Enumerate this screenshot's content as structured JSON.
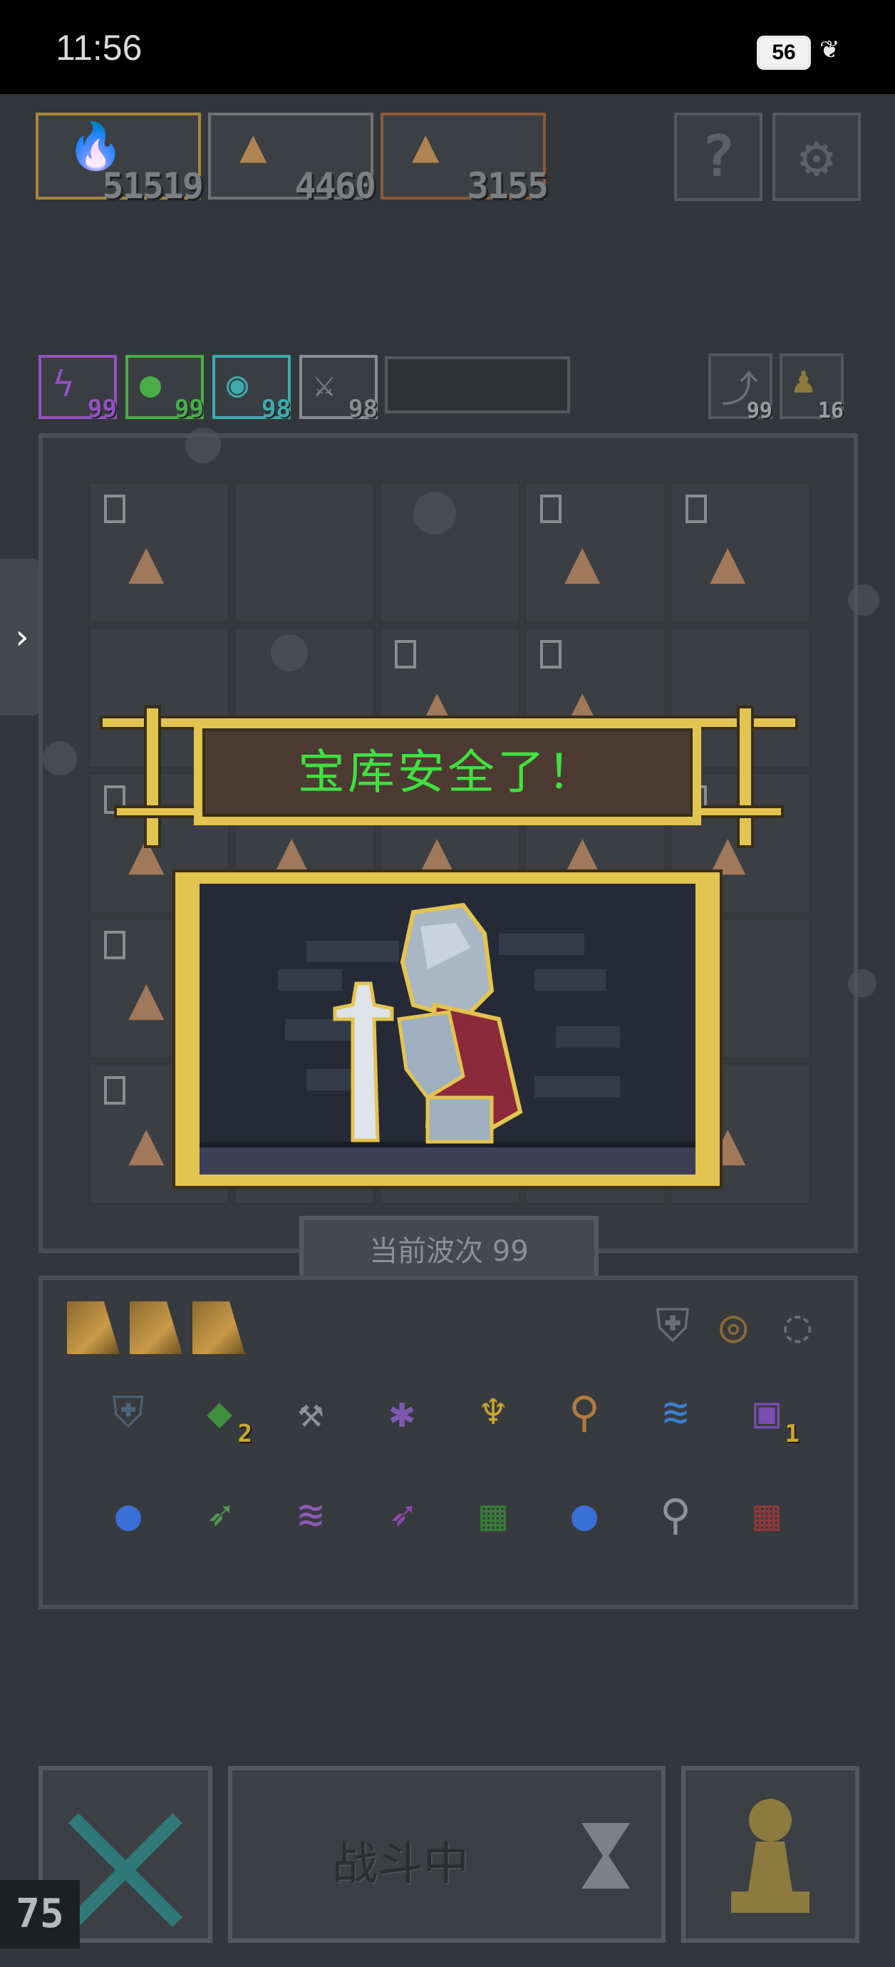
{
  "status_bar": {
    "time": "11:56",
    "battery": "56"
  },
  "resources": [
    {
      "id": "blue-gem",
      "amount": "51519",
      "border": "#a5873a",
      "icon": "blue-flame-icon",
      "color": "#4a7fd6"
    },
    {
      "id": "ore-1",
      "amount": "4460",
      "border": "#6e7275",
      "icon": "ore-pile-icon",
      "color": "#b08452"
    },
    {
      "id": "ore-2",
      "amount": "3155",
      "border": "#8b5a3a",
      "icon": "ore-pile-icon",
      "color": "#b08452"
    }
  ],
  "top_buttons": {
    "help": "?",
    "settings": "⚙"
  },
  "skills": [
    {
      "icon": "lightning-icon",
      "value": "99",
      "color": "#a259d9"
    },
    {
      "icon": "green-potion-icon",
      "value": "99",
      "color": "#4cc24c"
    },
    {
      "icon": "cyan-orb-icon",
      "value": "98",
      "color": "#3fc0c0"
    },
    {
      "icon": "crossed-swords-icon",
      "value": "98",
      "color": "#9a9ea2"
    }
  ],
  "counters": [
    {
      "icon": "return-arrow-icon",
      "value": "99"
    },
    {
      "icon": "pawn-icon",
      "value": "16"
    }
  ],
  "board": {
    "badge": "0",
    "cells": [
      [
        true,
        false,
        false,
        true,
        true
      ],
      [
        false,
        false,
        true,
        true,
        false
      ],
      [
        true,
        true,
        true,
        true,
        true
      ],
      [
        true,
        false,
        false,
        false,
        false
      ],
      [
        true,
        false,
        false,
        false,
        true
      ]
    ]
  },
  "banner": {
    "text": "宝库安全了！"
  },
  "wave": {
    "label": "当前波次 99"
  },
  "tabs": [
    "scroll-1",
    "scroll-2",
    "scroll-3"
  ],
  "filters": [
    "armor-filter-icon",
    "ring-filter-icon",
    "circle-filter-icon"
  ],
  "inventory": [
    {
      "icon": "shield-icon",
      "glyph": "⛨",
      "color": "#4d6378",
      "count": ""
    },
    {
      "icon": "green-gem-icon",
      "glyph": "◆",
      "color": "#3f8f3f",
      "count": "2"
    },
    {
      "icon": "hammer-icon",
      "glyph": "⚒",
      "color": "#8e9296",
      "count": ""
    },
    {
      "icon": "bat-icon",
      "glyph": "✱",
      "color": "#7d5ab0",
      "count": ""
    },
    {
      "icon": "chalice-icon",
      "glyph": "♆",
      "color": "#c9a52e",
      "count": ""
    },
    {
      "icon": "key-icon",
      "glyph": "⚲",
      "color": "#b07a40",
      "count": ""
    },
    {
      "icon": "wing-icon",
      "glyph": "≋",
      "color": "#3a7fd0",
      "count": ""
    },
    {
      "icon": "jar-icon",
      "glyph": "▣",
      "color": "#7a4db0",
      "count": "1"
    },
    {
      "icon": "water-drop-card-icon",
      "glyph": "●",
      "color": "#3a6fd6",
      "count": ""
    },
    {
      "icon": "green-arrow-icon",
      "glyph": "➶",
      "color": "#4f9a4f",
      "count": ""
    },
    {
      "icon": "purple-claw-icon",
      "glyph": "≋",
      "color": "#8d5ab8",
      "count": ""
    },
    {
      "icon": "purple-arrow-icon",
      "glyph": "➶",
      "color": "#8d4ab0",
      "count": ""
    },
    {
      "icon": "green-tile-icon",
      "glyph": "▦",
      "color": "#3a7a3a",
      "count": ""
    },
    {
      "icon": "water-drop-card-icon",
      "glyph": "●",
      "color": "#3a6fd6",
      "count": ""
    },
    {
      "icon": "lever-icon",
      "glyph": "⚲",
      "color": "#8e9296",
      "count": ""
    },
    {
      "icon": "red-tile-icon",
      "glyph": "▦",
      "color": "#8a3a3a",
      "count": ""
    }
  ],
  "bottom": {
    "fight_label": "战斗中",
    "fps": "75"
  }
}
